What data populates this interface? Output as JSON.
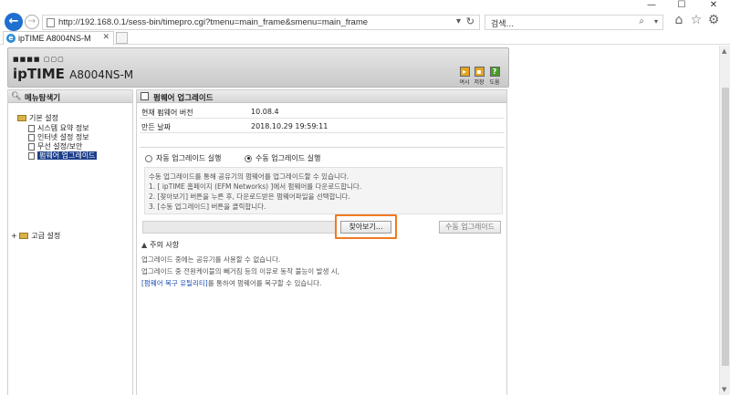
{
  "browser": {
    "url": "http://192.168.0.1/sess-bin/timepro.cgi?tmenu=main_frame&smenu=main_frame",
    "search_placeholder": "검색...",
    "tab_title": "ipTIME A8004NS-M",
    "window_controls": [
      "—",
      "☐",
      "✕"
    ]
  },
  "router": {
    "brand_dots": "■■■■ ▢▢▢",
    "brand": "ipTIME",
    "model": "A8004NS-M",
    "header_buttons": [
      {
        "label": "여시",
        "icon": "open-icon",
        "color": "#e2a522"
      },
      {
        "label": "저장",
        "icon": "save-icon",
        "color": "#e2a522"
      },
      {
        "label": "도움",
        "icon": "help-icon",
        "color": "#4a9a2a",
        "glyph": "?"
      }
    ]
  },
  "menu": {
    "title": "메뉴탐색기",
    "basic_settings": "기본 설정",
    "items": [
      "시스템 요약 정보",
      "인터넷 설정 정보",
      "무선 설정/보안",
      "펌웨어 업그레이드"
    ],
    "advanced_settings": "고급 설정",
    "expand_marker": "+"
  },
  "panel": {
    "title": "펌웨어 업그레이드",
    "rows": [
      {
        "key": "현재 펌웨어 버전",
        "value": "10.08.4"
      },
      {
        "key": "만든 날짜",
        "value": "2018.10.29 19:59:11"
      }
    ],
    "auto_upgrade": "자동 업그레이드 실행",
    "manual_upgrade": "수동 업그레이드 실행",
    "description": [
      "수동 업그레이드를 통해 공유기의 펌웨어를 업그레이드할 수 있습니다.",
      "1. [ ipTIME 홈페이지 (EFM Networks) ]에서 펌웨어를 다운로드합니다.",
      "2. [찾아보기] 버튼을 누른 후, 다운로드받은 펌웨어파일을 선택합니다.",
      "3. [수동 업그레이드] 버튼을 클릭합니다."
    ],
    "browse_button": "찾아보기...",
    "upgrade_button": "수동 업그레이드",
    "caution_title": "주의 사항",
    "caution_lines": [
      "업그레이드 중에는 공유기를 사용할 수 없습니다.",
      "업그레이드 중 전원케이블의 뻬거짐 등의 이유로 동작 불능이 발생 시,"
    ],
    "caution_link": "[펌웨어 복구 유틸리티]",
    "caution_tail": "를 통하여 펌웨어를 복구할 수 있습니다."
  },
  "colors": {
    "highlight": "#f07a23",
    "selected": "#1d3f8a",
    "link": "#1b4fb4"
  }
}
